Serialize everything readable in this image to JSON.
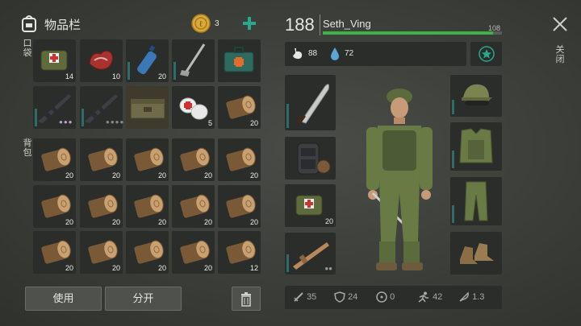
{
  "inventory": {
    "title": "物品栏",
    "coins": "3",
    "pocket_label": "口袋",
    "backpack_label": "背包",
    "pocket_slots": [
      {
        "name": "first-aid-kit",
        "icon": "first-aid-bag-icon",
        "qty": "14"
      },
      {
        "name": "raw-meat",
        "icon": "raw-meat-icon",
        "qty": "10"
      },
      {
        "name": "water-bottle",
        "icon": "water-bottle-icon",
        "qty": "20"
      },
      {
        "name": "golf-club",
        "icon": "golf-club-icon",
        "qty": ""
      },
      {
        "name": "medkit-box",
        "icon": "medkit-box-icon",
        "qty": ""
      },
      {
        "name": "assault-rifle-1",
        "icon": "assault-rifle-icon",
        "qty": ""
      },
      {
        "name": "assault-rifle-2",
        "icon": "assault-rifle-icon",
        "qty": ""
      },
      {
        "name": "ammo-crate",
        "icon": "ammo-crate-icon",
        "qty": ""
      },
      {
        "name": "bandages",
        "icon": "bandage-icon",
        "qty": "5"
      },
      {
        "name": "wood-log",
        "icon": "wood-log-icon",
        "qty": "20"
      }
    ],
    "backpack_slots": [
      "20",
      "20",
      "20",
      "20",
      "20",
      "20",
      "20",
      "20",
      "20",
      "20",
      "20",
      "20",
      "20",
      "20",
      "12"
    ],
    "use_button": "使用",
    "split_button": "分开"
  },
  "character": {
    "level": "188",
    "name": "Seth_Ving",
    "xp_value": "108",
    "xp_fraction": 0.95,
    "hunger": "88",
    "thirst": "72"
  },
  "close_label": "关闭",
  "stats": {
    "attack": "35",
    "armor": "24",
    "radiation": "0",
    "speed": "42",
    "weight": "1.3"
  },
  "colors": {
    "accent": "#2aa88e",
    "xp_bar": "#3fb04a",
    "slot": "#2b2d2b"
  }
}
